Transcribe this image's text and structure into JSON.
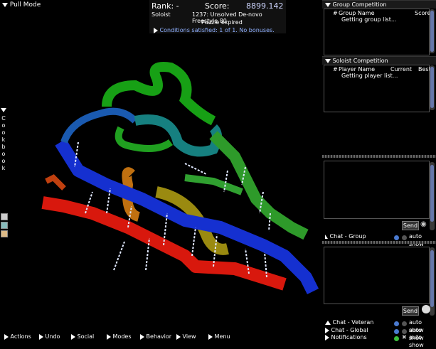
{
  "top_left": {
    "mode_label": "Pull Mode"
  },
  "score": {
    "rank_label": "Rank: -",
    "score_label": "Score:",
    "score_value": "8899.142",
    "mode": "Soloist",
    "puzzle": "1237: Unsolved De-novo Freestyle 80",
    "status": "Puzzle expired",
    "conditions": "Conditions satisfied: 1 of 1. No bonuses."
  },
  "group_competition": {
    "title": "Group Competition",
    "col_hash": "#",
    "col_name": "Group Name",
    "col_score": "Score",
    "loading": "Getting group list..."
  },
  "soloist_competition": {
    "title": "Soloist Competition",
    "col_hash": "#",
    "col_name": "Player Name",
    "col_current": "Current",
    "col_best": "Best",
    "loading": "Getting player list..."
  },
  "chat": {
    "send_label": "Send",
    "tabs": [
      {
        "label": "Chat - Group",
        "auto": "auto show"
      },
      {
        "label": "Chat - Veteran",
        "auto": "auto show"
      },
      {
        "label": "Chat - Global",
        "auto": "auto show"
      },
      {
        "label": "Notifications",
        "auto": "auto show"
      }
    ]
  },
  "cookbook": {
    "label": "C o o k b o o k"
  },
  "bottom_menu": [
    "Actions",
    "Undo",
    "Social",
    "Modes",
    "Behavior",
    "View",
    "Menu"
  ],
  "colors": {
    "panel_bg": "#000000",
    "accent_blue": "#6677aa",
    "header_bg": "#1a1a1a"
  }
}
